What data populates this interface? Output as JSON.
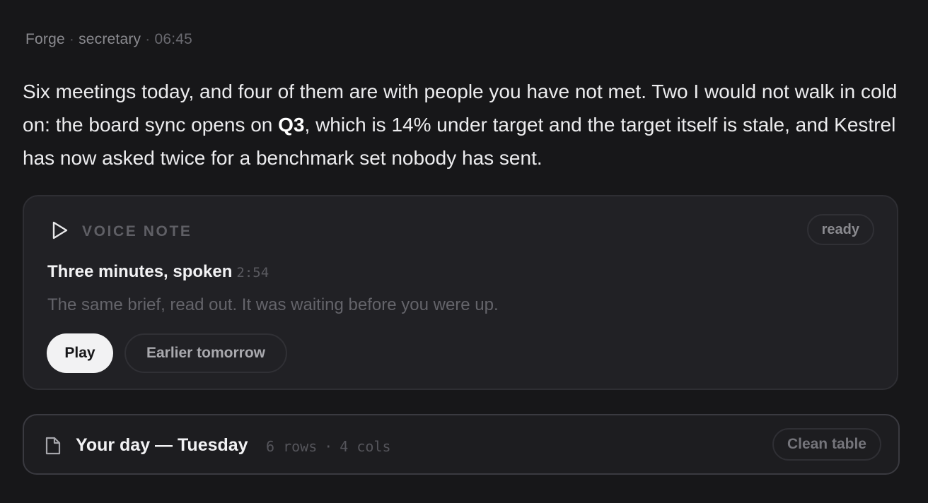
{
  "header": {
    "agent": "Forge",
    "role": "secretary",
    "time": "06:45",
    "separator": "·"
  },
  "message": {
    "part1": "Six meetings today, and four of them are with people you have not met. Two I would not walk in cold on: the board sync opens on ",
    "emphasis": "Q3",
    "part2": ", which is 14% under target and the target itself is stale, and Kestrel has now asked twice for a benchmark set nobody has sent."
  },
  "voice_note": {
    "label": "VOICE NOTE",
    "status": "ready",
    "title": "Three minutes, spoken",
    "duration": "2:54",
    "subtitle": "The same brief, read out. It was waiting before you were up.",
    "play_label": "Play",
    "later_label": "Earlier tomorrow",
    "icon": "play-icon"
  },
  "table_card": {
    "title": "Your day — Tuesday",
    "rows": "6 rows",
    "cols": "4 cols",
    "separator": "·",
    "action_label": "Clean table",
    "icon": "document-icon"
  },
  "colors": {
    "background": "#171719",
    "card": "#212125",
    "text": "#ececee",
    "muted": "#64646a",
    "primary_button": "#f2f2f3"
  }
}
